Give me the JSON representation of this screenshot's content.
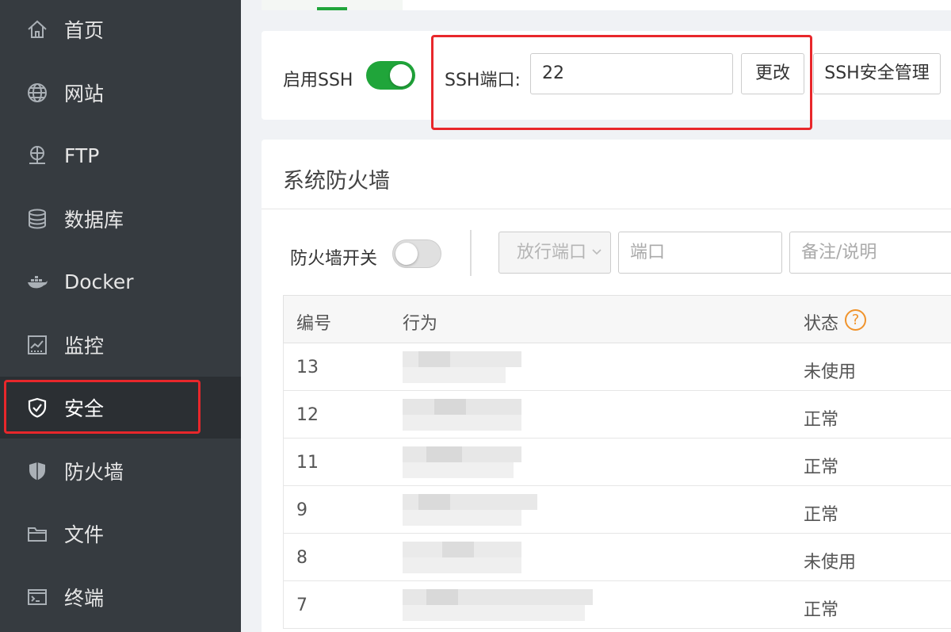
{
  "sidebar": {
    "items": [
      {
        "label": "首页",
        "icon": "home-icon"
      },
      {
        "label": "网站",
        "icon": "globe-icon"
      },
      {
        "label": "FTP",
        "icon": "ftp-icon"
      },
      {
        "label": "数据库",
        "icon": "database-icon"
      },
      {
        "label": "Docker",
        "icon": "docker-icon"
      },
      {
        "label": "监控",
        "icon": "monitor-icon"
      },
      {
        "label": "安全",
        "icon": "shield-check-icon",
        "active": true
      },
      {
        "label": "防火墙",
        "icon": "shield-icon"
      },
      {
        "label": "文件",
        "icon": "folder-icon"
      },
      {
        "label": "终端",
        "icon": "terminal-icon"
      }
    ]
  },
  "ssh": {
    "enable_label": "启用SSH",
    "enabled": true,
    "port_label": "SSH端口:",
    "port_value": "22",
    "change_button": "更改",
    "manage_button": "SSH安全管理"
  },
  "firewall": {
    "title": "系统防火墙",
    "switch_label": "防火墙开关",
    "switch_on": false,
    "rule_type_select": "放行端口",
    "port_placeholder": "端口",
    "note_placeholder": "备注/说明"
  },
  "table": {
    "headers": {
      "id": "编号",
      "action": "行为",
      "status": "状态"
    },
    "rows": [
      {
        "id": "13",
        "status": "未使用"
      },
      {
        "id": "12",
        "status": "正常"
      },
      {
        "id": "11",
        "status": "正常"
      },
      {
        "id": "9",
        "status": "正常"
      },
      {
        "id": "8",
        "status": "未使用"
      },
      {
        "id": "7",
        "status": "正常"
      }
    ]
  },
  "colors": {
    "accent": "#20a53a",
    "highlight": "#e8272b",
    "help": "#f0932b",
    "sidebar_bg": "#363b40"
  }
}
